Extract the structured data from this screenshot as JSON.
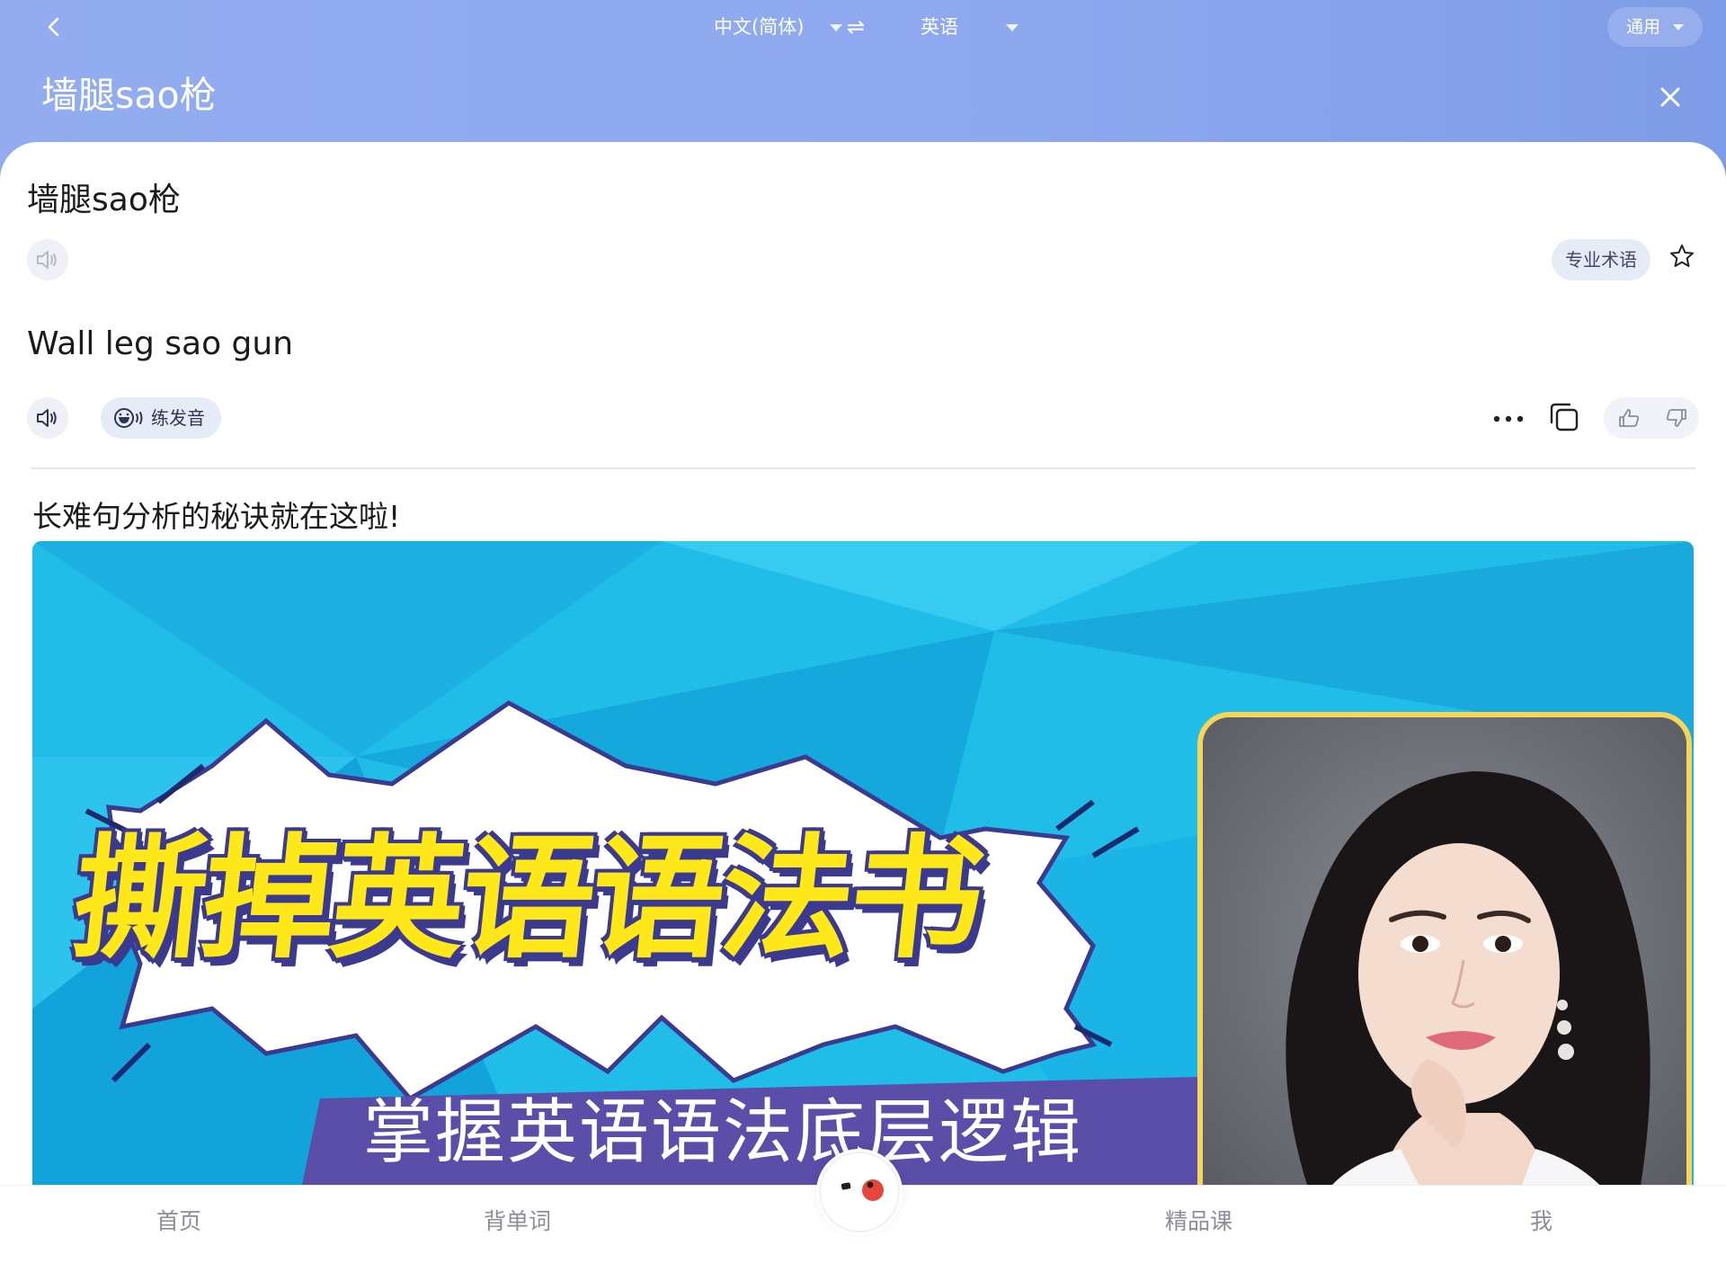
{
  "header": {
    "source_language": "中文(简体)",
    "swap_symbol": "⇌",
    "target_language": "英语",
    "domain": "通用",
    "query": "墙腿sao枪",
    "background_color": "#8ea9ef"
  },
  "result": {
    "source_text": "墙腿sao枪",
    "term_chip": "专业术语",
    "translation": "Wall leg sao gun",
    "practice_label": "练发音"
  },
  "ad": {
    "caption": "长难句分析的秘诀就在这啦!",
    "headline": "撕掉英语语法书",
    "subheadline": "掌握英语语法底层逻辑",
    "headline_color": "#ffe81a"
  },
  "tabbar": {
    "items": [
      {
        "label": "首页"
      },
      {
        "label": "背单词"
      },
      {
        "label": "精品课"
      },
      {
        "label": "我"
      }
    ]
  },
  "icons": [
    "back-icon",
    "caret-down-icon",
    "swap-icon",
    "close-icon",
    "speaker-icon",
    "star-icon",
    "pronunciation-icon",
    "more-icon",
    "copy-icon",
    "thumbs-up-icon",
    "thumbs-down-icon",
    "mascot-icon"
  ]
}
